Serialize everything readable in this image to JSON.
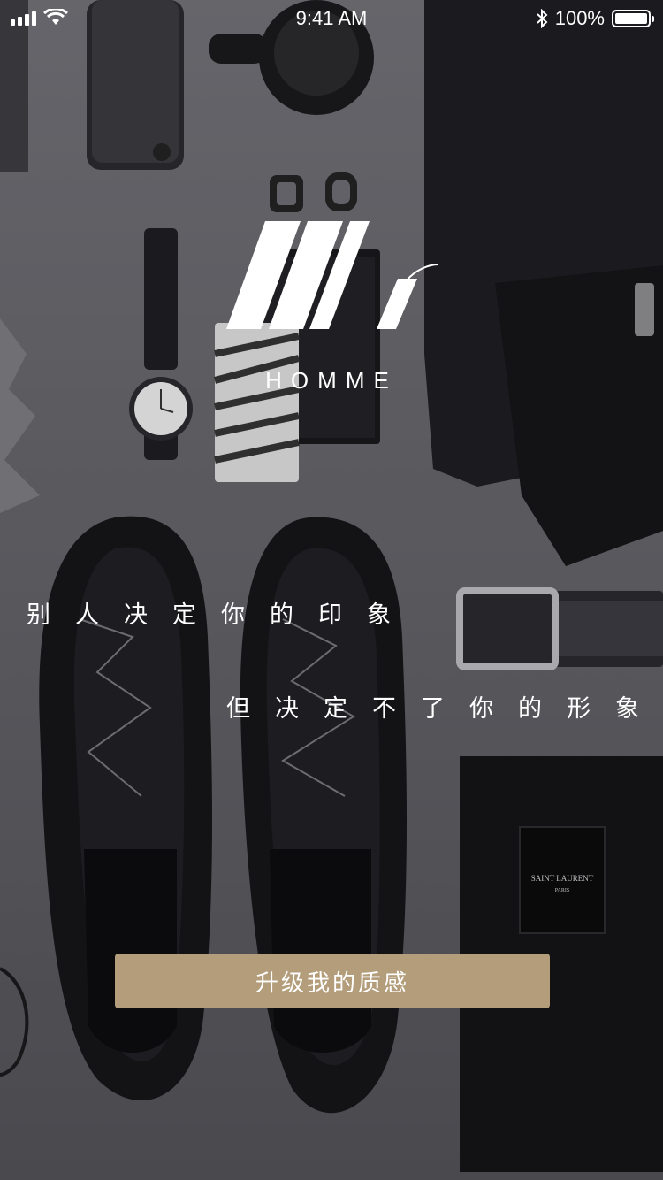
{
  "status_bar": {
    "time": "9:41 AM",
    "battery_percent": "100%",
    "battery_level": 1.0,
    "icons": [
      "signal-icon",
      "wifi-icon",
      "bluetooth-icon",
      "battery-icon"
    ]
  },
  "brand": {
    "logo_icon": "mr-logo-icon",
    "name": "HOMME"
  },
  "slogan": {
    "line1": "别人决定你的印象",
    "line2": "但决定不了你的形象"
  },
  "cta": {
    "label": "升级我的质感",
    "color": "#b39d7b"
  },
  "colors": {
    "text": "#ffffff",
    "accent": "#b39d7b"
  }
}
